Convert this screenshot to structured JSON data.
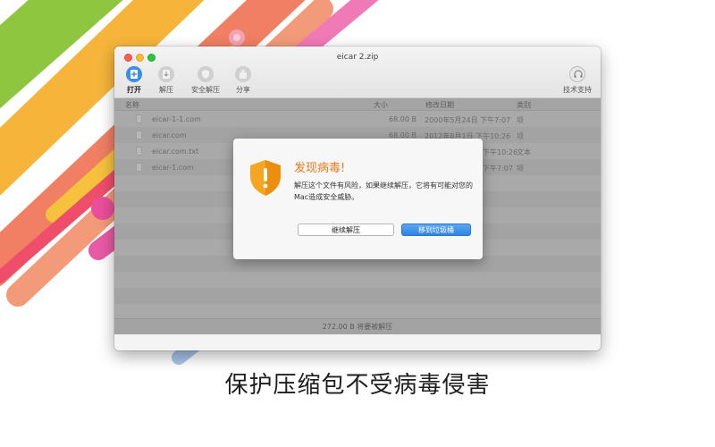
{
  "window": {
    "title": "eicar 2.zip",
    "toolbar": {
      "open_label": "打开",
      "extract_label": "解压",
      "safe_extract_label": "安全解压",
      "share_label": "分享",
      "support_label": "技术支持"
    }
  },
  "file_list": {
    "headers": {
      "name": "名称",
      "size": "大小",
      "modified": "修改日期",
      "kind": "类别"
    },
    "rows": [
      {
        "name": "eicar-1-1.com",
        "size": "68.00 B",
        "modified": "2000年5月24日 下午7:07",
        "kind": "项"
      },
      {
        "name": "eicar.com",
        "size": "68.00 B",
        "modified": "2012年8月1日 下午10:26",
        "kind": "项"
      },
      {
        "name": "eicar.com.txt",
        "size": "",
        "modified": "下午10:26",
        "kind": "文本"
      },
      {
        "name": "eicar-1.com",
        "size": "",
        "modified": "下午7:07",
        "kind": "项"
      }
    ]
  },
  "status_bar": {
    "text": "272.00 B 将要被解压"
  },
  "dialog": {
    "title": "发现病毒!",
    "message": "解压这个文件有风险，如果继续解压，它将有可能对您的Mac造成安全威胁。",
    "continue_label": "继续解压",
    "trash_label": "移到垃圾桶"
  },
  "caption": "保护压缩包不受病毒侵害",
  "colors": {
    "accent": "#3b8de6",
    "warning_orange": "#e57b1f",
    "shield_orange": "#f6a623"
  }
}
